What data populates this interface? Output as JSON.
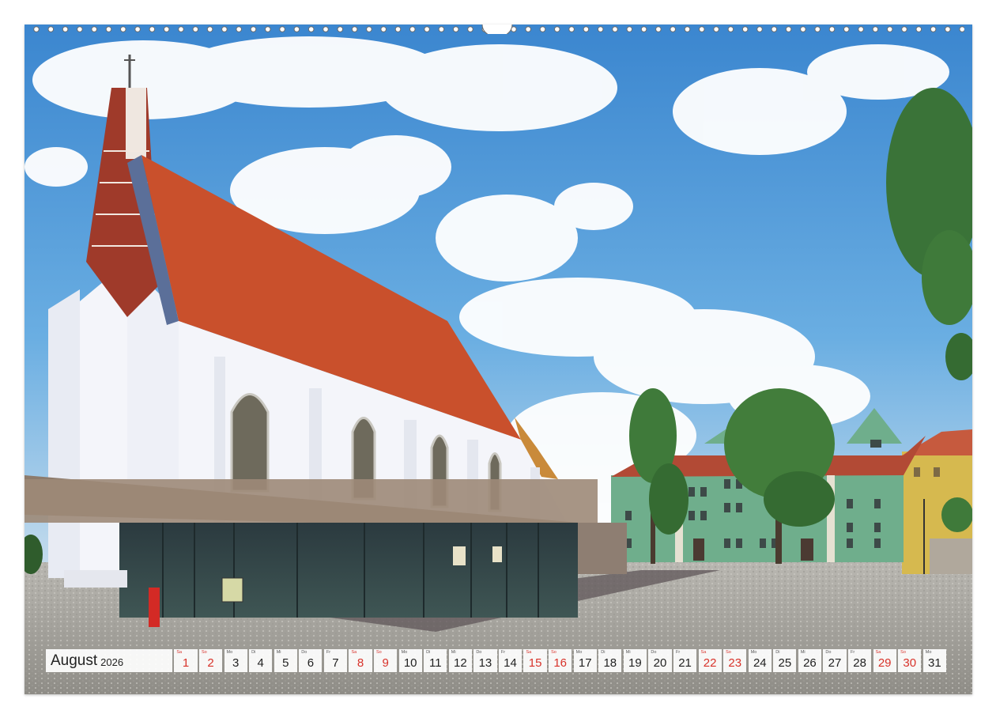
{
  "calendar": {
    "month": "August",
    "year": "2026",
    "days": [
      {
        "weekday": "Sa",
        "num": "1",
        "weekend": true
      },
      {
        "weekday": "So",
        "num": "2",
        "weekend": true
      },
      {
        "weekday": "Mo",
        "num": "3",
        "weekend": false
      },
      {
        "weekday": "Di",
        "num": "4",
        "weekend": false
      },
      {
        "weekday": "Mi",
        "num": "5",
        "weekend": false
      },
      {
        "weekday": "Do",
        "num": "6",
        "weekend": false
      },
      {
        "weekday": "Fr",
        "num": "7",
        "weekend": false
      },
      {
        "weekday": "Sa",
        "num": "8",
        "weekend": true
      },
      {
        "weekday": "So",
        "num": "9",
        "weekend": true
      },
      {
        "weekday": "Mo",
        "num": "10",
        "weekend": false
      },
      {
        "weekday": "Di",
        "num": "11",
        "weekend": false
      },
      {
        "weekday": "Mi",
        "num": "12",
        "weekend": false
      },
      {
        "weekday": "Do",
        "num": "13",
        "weekend": false
      },
      {
        "weekday": "Fr",
        "num": "14",
        "weekend": false
      },
      {
        "weekday": "Sa",
        "num": "15",
        "weekend": true
      },
      {
        "weekday": "So",
        "num": "16",
        "weekend": true
      },
      {
        "weekday": "Mo",
        "num": "17",
        "weekend": false
      },
      {
        "weekday": "Di",
        "num": "18",
        "weekend": false
      },
      {
        "weekday": "Mi",
        "num": "19",
        "weekend": false
      },
      {
        "weekday": "Do",
        "num": "20",
        "weekend": false
      },
      {
        "weekday": "Fr",
        "num": "21",
        "weekend": false
      },
      {
        "weekday": "Sa",
        "num": "22",
        "weekend": true
      },
      {
        "weekday": "So",
        "num": "23",
        "weekend": true
      },
      {
        "weekday": "Mo",
        "num": "24",
        "weekend": false
      },
      {
        "weekday": "Di",
        "num": "25",
        "weekend": false
      },
      {
        "weekday": "Mi",
        "num": "26",
        "weekend": false
      },
      {
        "weekday": "Do",
        "num": "27",
        "weekend": false
      },
      {
        "weekday": "Fr",
        "num": "28",
        "weekend": false
      },
      {
        "weekday": "Sa",
        "num": "29",
        "weekend": true
      },
      {
        "weekday": "So",
        "num": "30",
        "weekend": true
      },
      {
        "weekday": "Mo",
        "num": "31",
        "weekend": false
      }
    ]
  },
  "colors": {
    "weekend": "#d8322a",
    "sky": "#3f8fd4",
    "roof": "#c9502c",
    "church_wall": "#f4f5fa",
    "green_building": "#6fae8c",
    "cobblestone": "#b5b3ad"
  }
}
